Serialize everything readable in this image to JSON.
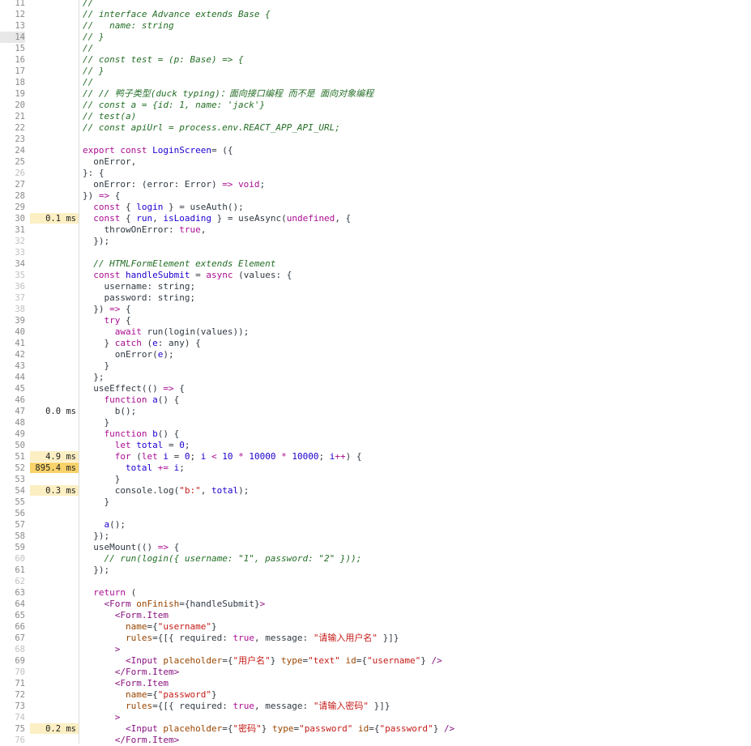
{
  "gutter": {
    "timings": [
      {
        "line": 30,
        "text": "0.1 ms",
        "level": "low"
      },
      {
        "line": 47,
        "text": "0.0 ms",
        "level": "none"
      },
      {
        "line": 51,
        "text": "4.9 ms",
        "level": "low"
      },
      {
        "line": 52,
        "text": "895.4 ms",
        "level": "high"
      },
      {
        "line": 54,
        "text": "0.3 ms",
        "level": "low"
      },
      {
        "line": 75,
        "text": "0.2 ms",
        "level": "low"
      }
    ],
    "current_line": 14,
    "dim_lines": [
      26,
      32,
      33,
      35,
      36,
      37,
      38,
      60,
      62,
      68,
      70,
      74,
      76
    ]
  },
  "lines": [
    {
      "n": 11,
      "segs": [
        [
          "c",
          "//"
        ]
      ]
    },
    {
      "n": 12,
      "segs": [
        [
          "c",
          "// interface Advance extends Base {"
        ]
      ]
    },
    {
      "n": 13,
      "segs": [
        [
          "c",
          "//   name: string"
        ]
      ]
    },
    {
      "n": 14,
      "segs": [
        [
          "c",
          "// }"
        ]
      ]
    },
    {
      "n": 15,
      "segs": [
        [
          "c",
          "//"
        ]
      ]
    },
    {
      "n": 16,
      "segs": [
        [
          "c",
          "// const test = (p: Base) => {"
        ]
      ]
    },
    {
      "n": 17,
      "segs": [
        [
          "c",
          "// }"
        ]
      ]
    },
    {
      "n": 18,
      "segs": [
        [
          "c",
          "//"
        ]
      ]
    },
    {
      "n": 19,
      "segs": [
        [
          "c",
          "// // 鸭子类型(duck typing)：面向接口编程 而不是 面向对象编程"
        ]
      ]
    },
    {
      "n": 20,
      "segs": [
        [
          "c",
          "// const a = {id: 1, name: 'jack'}"
        ]
      ]
    },
    {
      "n": 21,
      "segs": [
        [
          "c",
          "// test(a)"
        ]
      ]
    },
    {
      "n": 22,
      "segs": [
        [
          "c",
          "// const apiUrl = process.env.REACT_APP_API_URL;"
        ]
      ]
    },
    {
      "n": 23,
      "segs": []
    },
    {
      "n": 24,
      "segs": [
        [
          "k",
          "export const "
        ],
        [
          "n",
          "LoginScreen"
        ],
        [
          "",
          "= ({"
        ]
      ]
    },
    {
      "n": 25,
      "segs": [
        [
          "",
          "  onError,"
        ]
      ]
    },
    {
      "n": 26,
      "segs": [
        [
          "",
          "}: {"
        ]
      ]
    },
    {
      "n": 27,
      "segs": [
        [
          "",
          "  onError: (error: Error) "
        ],
        [
          "k",
          "=>"
        ],
        [
          "",
          " "
        ],
        [
          "k",
          "void"
        ],
        [
          "",
          ";"
        ]
      ]
    },
    {
      "n": 28,
      "segs": [
        [
          "",
          "}) "
        ],
        [
          "k",
          "=>"
        ],
        [
          "",
          " {"
        ]
      ]
    },
    {
      "n": 29,
      "segs": [
        [
          "",
          "  "
        ],
        [
          "k",
          "const"
        ],
        [
          "",
          " { "
        ],
        [
          "n",
          "login"
        ],
        [
          "",
          " } = useAuth();"
        ]
      ]
    },
    {
      "n": 30,
      "segs": [
        [
          "",
          "  "
        ],
        [
          "k",
          "const"
        ],
        [
          "",
          " { "
        ],
        [
          "n",
          "run"
        ],
        [
          "",
          ", "
        ],
        [
          "n",
          "isLoading"
        ],
        [
          "",
          " } = useAsync("
        ],
        [
          "k",
          "undefined"
        ],
        [
          "",
          ", {"
        ]
      ]
    },
    {
      "n": 31,
      "segs": [
        [
          "",
          "    throwOnError: "
        ],
        [
          "k",
          "true"
        ],
        [
          "",
          ","
        ]
      ]
    },
    {
      "n": 32,
      "segs": [
        [
          "",
          "  });"
        ]
      ]
    },
    {
      "n": 33,
      "segs": []
    },
    {
      "n": 34,
      "segs": [
        [
          "",
          "  "
        ],
        [
          "c",
          "// HTMLFormElement extends Element"
        ]
      ]
    },
    {
      "n": 35,
      "segs": [
        [
          "",
          "  "
        ],
        [
          "k",
          "const"
        ],
        [
          "",
          " "
        ],
        [
          "n",
          "handleSubmit"
        ],
        [
          "",
          " = "
        ],
        [
          "k",
          "async"
        ],
        [
          "",
          " (values: {"
        ]
      ]
    },
    {
      "n": 36,
      "segs": [
        [
          "",
          "    username: string;"
        ]
      ]
    },
    {
      "n": 37,
      "segs": [
        [
          "",
          "    password: string;"
        ]
      ]
    },
    {
      "n": 38,
      "segs": [
        [
          "",
          "  }) "
        ],
        [
          "k",
          "=>"
        ],
        [
          "",
          " {"
        ]
      ]
    },
    {
      "n": 39,
      "segs": [
        [
          "",
          "    "
        ],
        [
          "k",
          "try"
        ],
        [
          "",
          " {"
        ]
      ]
    },
    {
      "n": 40,
      "segs": [
        [
          "",
          "      "
        ],
        [
          "k",
          "await"
        ],
        [
          "",
          " run(login(values));"
        ]
      ]
    },
    {
      "n": 41,
      "segs": [
        [
          "",
          "    } "
        ],
        [
          "k",
          "catch"
        ],
        [
          "",
          " ("
        ],
        [
          "n",
          "e"
        ],
        [
          "",
          ": any) {"
        ]
      ]
    },
    {
      "n": 42,
      "segs": [
        [
          "",
          "      onError("
        ],
        [
          "n",
          "e"
        ],
        [
          "",
          ");"
        ]
      ]
    },
    {
      "n": 43,
      "segs": [
        [
          "",
          "    }"
        ]
      ]
    },
    {
      "n": 44,
      "segs": [
        [
          "",
          "  };"
        ]
      ]
    },
    {
      "n": 45,
      "segs": [
        [
          "",
          "  useEffect(() "
        ],
        [
          "k",
          "=>"
        ],
        [
          "",
          " {"
        ]
      ]
    },
    {
      "n": 46,
      "segs": [
        [
          "",
          "    "
        ],
        [
          "k",
          "function"
        ],
        [
          "",
          " "
        ],
        [
          "n",
          "a"
        ],
        [
          "",
          "() {"
        ]
      ]
    },
    {
      "n": 47,
      "segs": [
        [
          "",
          "      b();"
        ]
      ]
    },
    {
      "n": 48,
      "segs": [
        [
          "",
          "    }"
        ]
      ]
    },
    {
      "n": 49,
      "segs": [
        [
          "",
          "    "
        ],
        [
          "k",
          "function"
        ],
        [
          "",
          " "
        ],
        [
          "n",
          "b"
        ],
        [
          "",
          "() {"
        ]
      ]
    },
    {
      "n": 50,
      "segs": [
        [
          "",
          "      "
        ],
        [
          "k",
          "let"
        ],
        [
          "",
          " "
        ],
        [
          "n",
          "total"
        ],
        [
          "",
          " = "
        ],
        [
          "n",
          "0"
        ],
        [
          "",
          ";"
        ]
      ]
    },
    {
      "n": 51,
      "segs": [
        [
          "",
          "      "
        ],
        [
          "k",
          "for"
        ],
        [
          "",
          " ("
        ],
        [
          "k",
          "let"
        ],
        [
          "",
          " "
        ],
        [
          "n",
          "i"
        ],
        [
          "",
          " = "
        ],
        [
          "n",
          "0"
        ],
        [
          "",
          "; "
        ],
        [
          "n",
          "i"
        ],
        [
          "",
          " "
        ],
        [
          "k",
          "<"
        ],
        [
          "",
          " "
        ],
        [
          "n",
          "10"
        ],
        [
          "",
          " "
        ],
        [
          "k",
          "*"
        ],
        [
          "",
          " "
        ],
        [
          "n",
          "10000"
        ],
        [
          "",
          " "
        ],
        [
          "k",
          "*"
        ],
        [
          "",
          " "
        ],
        [
          "n",
          "10000"
        ],
        [
          "",
          "; "
        ],
        [
          "n",
          "i"
        ],
        [
          "k",
          "++"
        ],
        [
          "",
          ") {"
        ]
      ]
    },
    {
      "n": 52,
      "segs": [
        [
          "",
          "        "
        ],
        [
          "n",
          "total"
        ],
        [
          "",
          " "
        ],
        [
          "k",
          "+="
        ],
        [
          "",
          " "
        ],
        [
          "n",
          "i"
        ],
        [
          "",
          ";"
        ]
      ]
    },
    {
      "n": 53,
      "segs": [
        [
          "",
          "      }"
        ]
      ]
    },
    {
      "n": 54,
      "segs": [
        [
          "",
          "      console.log("
        ],
        [
          "s",
          "\"b:\""
        ],
        [
          "",
          ", "
        ],
        [
          "n",
          "total"
        ],
        [
          "",
          ");"
        ]
      ]
    },
    {
      "n": 55,
      "segs": [
        [
          "",
          "    }"
        ]
      ]
    },
    {
      "n": 56,
      "segs": []
    },
    {
      "n": 57,
      "segs": [
        [
          "",
          "    "
        ],
        [
          "n",
          "a"
        ],
        [
          "",
          "();"
        ]
      ]
    },
    {
      "n": 58,
      "segs": [
        [
          "",
          "  });"
        ]
      ]
    },
    {
      "n": 59,
      "segs": [
        [
          "",
          "  useMount(() "
        ],
        [
          "k",
          "=>"
        ],
        [
          "",
          " {"
        ]
      ]
    },
    {
      "n": 60,
      "segs": [
        [
          "",
          "    "
        ],
        [
          "c",
          "// run(login({ username: \"1\", password: \"2\" }));"
        ]
      ]
    },
    {
      "n": 61,
      "segs": [
        [
          "",
          "  });"
        ]
      ]
    },
    {
      "n": 62,
      "segs": []
    },
    {
      "n": 63,
      "segs": [
        [
          "",
          "  "
        ],
        [
          "k",
          "return"
        ],
        [
          "",
          " ("
        ]
      ]
    },
    {
      "n": 64,
      "segs": [
        [
          "",
          "    "
        ],
        [
          "t",
          "<Form"
        ],
        [
          "",
          " "
        ],
        [
          "a",
          "onFinish"
        ],
        [
          "",
          "={handleSubmit}"
        ],
        [
          "t",
          ">"
        ]
      ]
    },
    {
      "n": 65,
      "segs": [
        [
          "",
          "      "
        ],
        [
          "t",
          "<Form.Item"
        ]
      ]
    },
    {
      "n": 66,
      "segs": [
        [
          "",
          "        "
        ],
        [
          "a",
          "name"
        ],
        [
          "",
          "={"
        ],
        [
          "s",
          "\"username\""
        ],
        [
          "",
          "}"
        ]
      ]
    },
    {
      "n": 67,
      "segs": [
        [
          "",
          "        "
        ],
        [
          "a",
          "rules"
        ],
        [
          "",
          "={[{ required: "
        ],
        [
          "k",
          "true"
        ],
        [
          "",
          ", message: "
        ],
        [
          "s",
          "\"请输入用户名\""
        ],
        [
          "",
          " }]}"
        ]
      ]
    },
    {
      "n": 68,
      "segs": [
        [
          "",
          "      "
        ],
        [
          "t",
          ">"
        ]
      ]
    },
    {
      "n": 69,
      "segs": [
        [
          "",
          "        "
        ],
        [
          "t",
          "<Input"
        ],
        [
          "",
          " "
        ],
        [
          "a",
          "placeholder"
        ],
        [
          "",
          "={"
        ],
        [
          "s",
          "\"用户名\""
        ],
        [
          "",
          "} "
        ],
        [
          "a",
          "type"
        ],
        [
          "",
          "="
        ],
        [
          "s",
          "\"text\""
        ],
        [
          "",
          " "
        ],
        [
          "a",
          "id"
        ],
        [
          "",
          "={"
        ],
        [
          "s",
          "\"username\""
        ],
        [
          "",
          "} "
        ],
        [
          "t",
          "/>"
        ]
      ]
    },
    {
      "n": 70,
      "segs": [
        [
          "",
          "      "
        ],
        [
          "t",
          "</Form.Item>"
        ]
      ]
    },
    {
      "n": 71,
      "segs": [
        [
          "",
          "      "
        ],
        [
          "t",
          "<Form.Item"
        ]
      ]
    },
    {
      "n": 72,
      "segs": [
        [
          "",
          "        "
        ],
        [
          "a",
          "name"
        ],
        [
          "",
          "={"
        ],
        [
          "s",
          "\"password\""
        ],
        [
          "",
          "}"
        ]
      ]
    },
    {
      "n": 73,
      "segs": [
        [
          "",
          "        "
        ],
        [
          "a",
          "rules"
        ],
        [
          "",
          "={[{ required: "
        ],
        [
          "k",
          "true"
        ],
        [
          "",
          ", message: "
        ],
        [
          "s",
          "\"请输入密码\""
        ],
        [
          "",
          " }]}"
        ]
      ]
    },
    {
      "n": 74,
      "segs": [
        [
          "",
          "      "
        ],
        [
          "t",
          ">"
        ]
      ]
    },
    {
      "n": 75,
      "segs": [
        [
          "",
          "        "
        ],
        [
          "t",
          "<Input"
        ],
        [
          "",
          " "
        ],
        [
          "a",
          "placeholder"
        ],
        [
          "",
          "={"
        ],
        [
          "s",
          "\"密码\""
        ],
        [
          "",
          "} "
        ],
        [
          "a",
          "type"
        ],
        [
          "",
          "="
        ],
        [
          "s",
          "\"password\""
        ],
        [
          "",
          " "
        ],
        [
          "a",
          "id"
        ],
        [
          "",
          "={"
        ],
        [
          "s",
          "\"password\""
        ],
        [
          "",
          "} "
        ],
        [
          "t",
          "/>"
        ]
      ]
    },
    {
      "n": 76,
      "segs": [
        [
          "",
          "      "
        ],
        [
          "t",
          "</Form.Item>"
        ]
      ]
    }
  ]
}
